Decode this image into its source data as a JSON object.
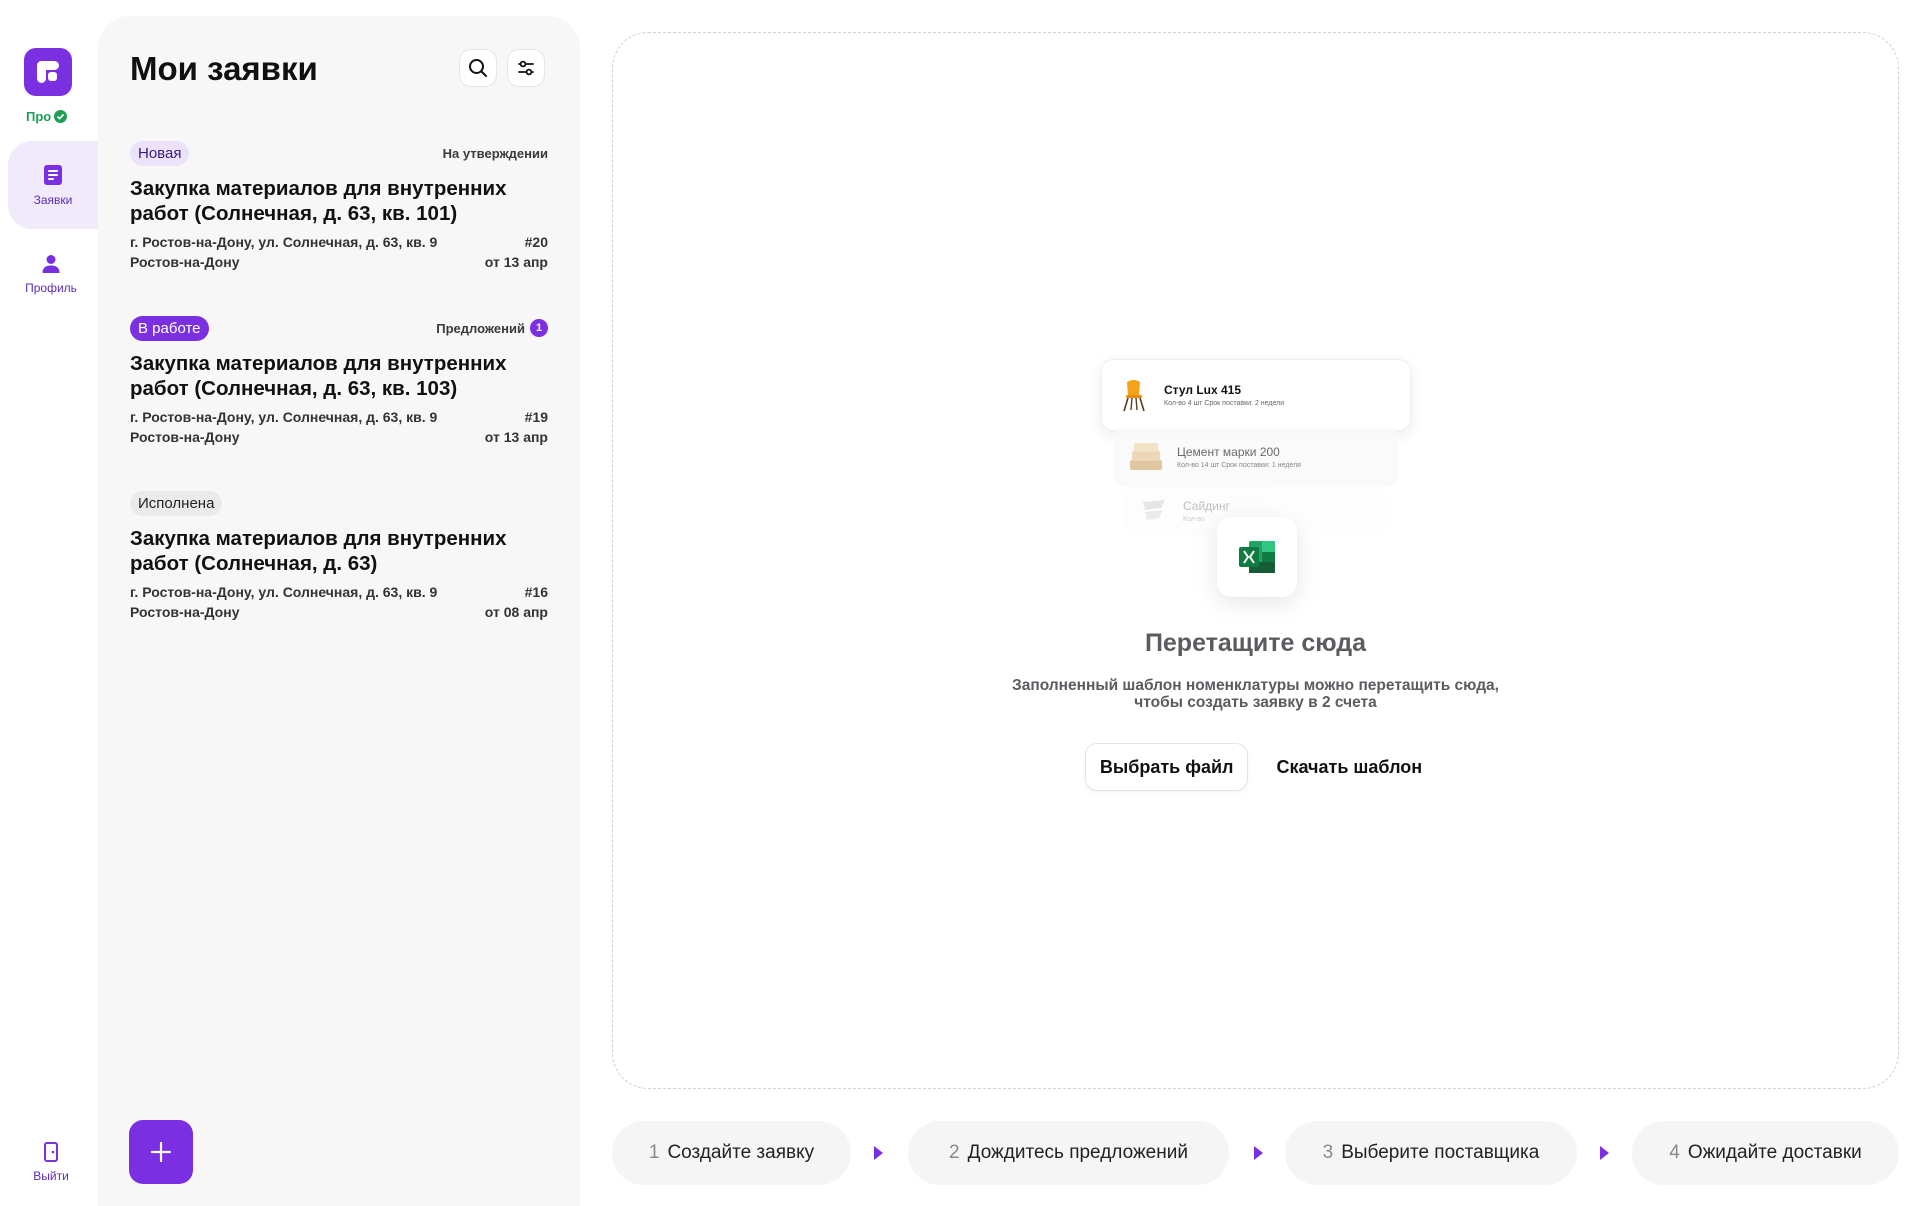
{
  "sidebar": {
    "pro_label": "Про",
    "nav": [
      {
        "label": "Заявки",
        "icon": "orders-icon"
      },
      {
        "label": "Профиль",
        "icon": "user-icon"
      }
    ],
    "logout_label": "Выйти"
  },
  "panel": {
    "title": "Мои заявки",
    "orders": [
      {
        "status": "Новая",
        "right_label": "На утверждении",
        "title": "Закупка материалов для внутренних работ (Солнечная, д. 63, кв. 101)",
        "address": "г. Ростов-на-Дону, ул. Солнечная, д. 63, кв. 9",
        "number": "#20",
        "city": "Ростов-на-Дону",
        "date": "от 13 апр"
      },
      {
        "status": "В работе",
        "right_label": "Предложений",
        "offers_count": "1",
        "title": "Закупка материалов для внутренних работ (Солнечная, д. 63, кв. 103)",
        "address": "г. Ростов-на-Дону, ул. Солнечная, д. 63, кв. 9",
        "number": "#19",
        "city": "Ростов-на-Дону",
        "date": "от 13 апр"
      },
      {
        "status": "Исполнена",
        "title": "Закупка материалов для внутренних работ (Солнечная, д. 63)",
        "address": "г. Ростов-на-Дону, ул. Солнечная, д. 63, кв. 9",
        "number": "#16",
        "city": "Ростов-на-Дону",
        "date": "от 08 апр"
      }
    ]
  },
  "dropzone": {
    "cards": [
      {
        "name": "Стул Lux 415",
        "sub": "Кол-во 4 шт   Срок поставки: 2 недели"
      },
      {
        "name": "Цемент марки 200",
        "sub": "Кол-во 14 шт   Срок поставки: 1 неделя"
      },
      {
        "name": "Сайдинг",
        "sub": "Кол-во"
      }
    ],
    "title": "Перетащите сюда",
    "description_line1": "Заполненный шаблон номенклатуры можно перетащить сюда,",
    "description_line2": "чтобы создать заявку в 2 счета",
    "choose_file": "Выбрать файл",
    "download_template": "Скачать шаблон"
  },
  "steps": [
    {
      "num": "1",
      "label": "Создайте заявку"
    },
    {
      "num": "2",
      "label": "Дождитесь предложений"
    },
    {
      "num": "3",
      "label": "Выберите поставщика"
    },
    {
      "num": "4",
      "label": "Ожидайте доставки"
    }
  ],
  "colors": {
    "accent": "#7a2fe0",
    "pro_green": "#1f9e55",
    "panel_bg": "#f7f7f8"
  }
}
